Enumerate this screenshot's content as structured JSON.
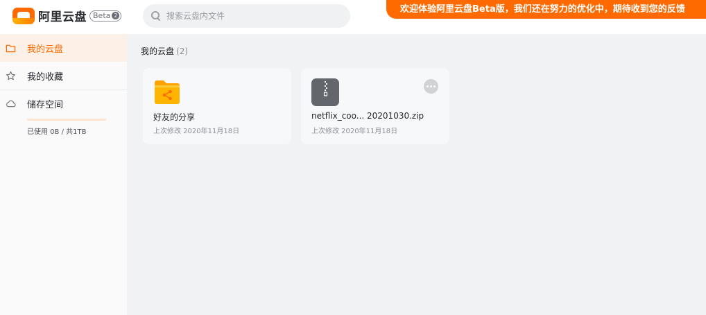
{
  "header": {
    "brand": "阿里云盘",
    "beta_label": "Beta",
    "beta_marker": "2",
    "search": {
      "placeholder": "搜索云盘内文件",
      "value": ""
    },
    "banner_text": "欢迎体验阿里云盘Beta版，我们还在努力的优化中，期待收到您的反馈"
  },
  "sidebar": {
    "items": [
      {
        "label": "我的云盘",
        "icon": "folder-icon",
        "active": true
      },
      {
        "label": "我的收藏",
        "icon": "star-icon",
        "active": false
      },
      {
        "label": "储存空间",
        "icon": "cloud-icon",
        "active": false
      }
    ],
    "storage": {
      "used_text": "已使用 0B / 共1TB",
      "used_fraction": 0
    }
  },
  "main": {
    "breadcrumb": {
      "title": "我的云盘",
      "count": "(2)"
    },
    "files": [
      {
        "name": "好友的分享",
        "modified": "上次修改 2020年11月18日",
        "icon": "shared-folder-icon"
      },
      {
        "name": "netflix_coo... 20201030.zip",
        "modified": "上次修改 2020年11月18日",
        "icon": "zip-file-icon"
      }
    ]
  },
  "colors": {
    "accent": "#ff6a00",
    "folder": "#ffb400",
    "sidebar_bg": "#fafafb",
    "content_bg": "#f1f2f4",
    "card_bg": "#f7f8fa"
  }
}
